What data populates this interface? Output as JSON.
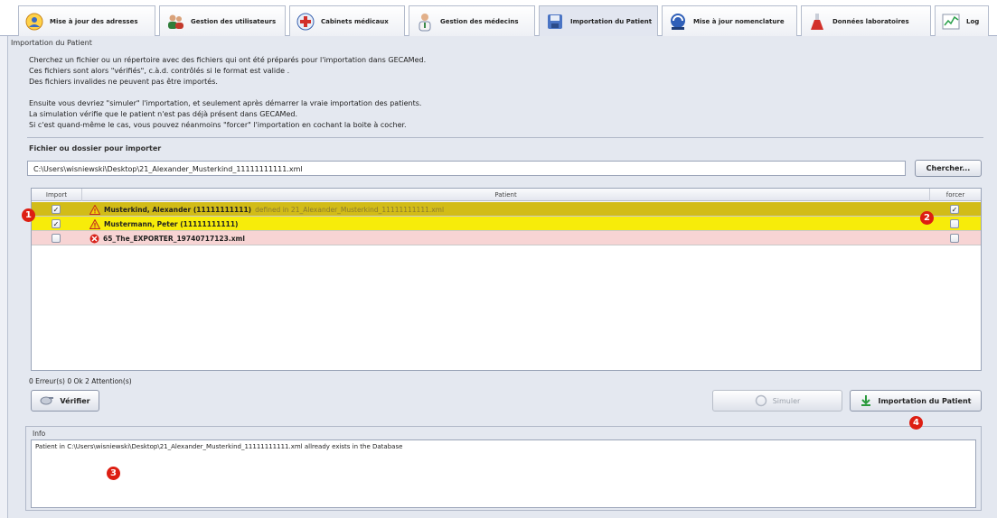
{
  "tabs": [
    {
      "label": "Mise à jour des adresses",
      "icon": "address-update-icon",
      "active": false
    },
    {
      "label": "Gestion des utilisateurs",
      "icon": "users-icon",
      "active": false
    },
    {
      "label": "Cabinets médicaux",
      "icon": "medical-office-icon",
      "active": false
    },
    {
      "label": "Gestion des médecins",
      "icon": "doctor-icon",
      "active": false
    },
    {
      "label": "Importation du Patient",
      "icon": "import-disk-icon",
      "active": true
    },
    {
      "label": "Mise à jour nomenclature",
      "icon": "nomenclature-icon",
      "active": false
    },
    {
      "label": "Données laboratoires",
      "icon": "lab-flask-icon",
      "active": false
    },
    {
      "label": "Log",
      "icon": "log-chart-icon",
      "active": false
    }
  ],
  "panel_title": "Importation du Patient",
  "description": [
    "Cherchez un fichier ou un répertoire avec des fichiers qui ont été préparés pour l'importation dans GECAMed.",
    "Ces fichiers sont alors \"vérifiés\", c.à.d. contrôlés si le format est valide .",
    "Des fichiers invalides ne peuvent pas être importés.",
    "",
    "Ensuite vous devriez \"simuler\" l'importation, et seulement après démarrer la vraie importation des patients.",
    "La simulation vérifie que le patient n'est pas déjà présent dans GECAMed.",
    "Si c'est quand-même le cas, vous pouvez néanmoins \"forcer\" l'importation en cochant la boite à cocher."
  ],
  "file_section": {
    "label": "Fichier ou dossier pour importer",
    "path": "C:\\Users\\wisniewski\\Desktop\\21_Alexander_Musterkind_11111111111.xml",
    "browse_button": "Chercher..."
  },
  "table": {
    "columns": [
      "Import",
      "Patient",
      "forcer"
    ],
    "rows": [
      {
        "import": true,
        "status": "warning",
        "patient": "Musterkind, Alexander (11111111111)",
        "note": "defined in 21_Alexander_Musterkind_11111111111.xml",
        "force": true,
        "color": "#d2bc18"
      },
      {
        "import": true,
        "status": "warning",
        "patient": "Mustermann, Peter (11111111111)",
        "note": "",
        "force": false,
        "color": "#f7ec0a"
      },
      {
        "import": false,
        "status": "error",
        "patient": "65_The_EXPORTER_19740717123.xml",
        "note": "",
        "force": false,
        "color": "#f7d4d4"
      }
    ]
  },
  "summary": "0 Erreur(s)  0 Ok  2 Attention(s)",
  "buttons": {
    "verify": "Vérifier",
    "simulate": "Simuler",
    "import": "Importation du Patient"
  },
  "info": {
    "label": "Info",
    "text": "Patient in C:\\Users\\wisniewski\\Desktop\\21_Alexander_Musterkind_11111111111.xml allready exists in the Database"
  },
  "markers": [
    "1",
    "2",
    "3",
    "4"
  ]
}
